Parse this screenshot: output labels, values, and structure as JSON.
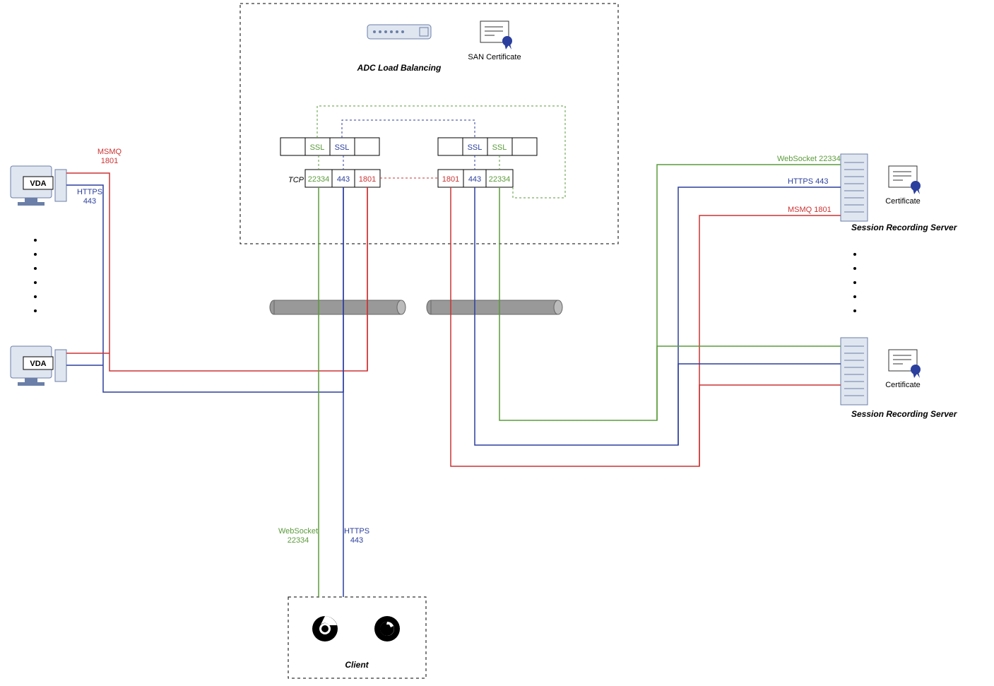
{
  "adc": {
    "title": "ADC Load Balancing",
    "san": "SAN Certificate"
  },
  "ssl": [
    "SSL",
    "SSL",
    "SSL",
    "SSL"
  ],
  "tcpRow": {
    "label": "TCP",
    "p": [
      "22334",
      "443",
      "1801",
      "1801",
      "443",
      "22334"
    ]
  },
  "vda": {
    "label": "VDA",
    "msmq": "MSMQ",
    "p1801": "1801",
    "https": "HTTPS",
    "p443": "443"
  },
  "srs": {
    "label": "Session Recording Server",
    "cert": "Certificate",
    "ws": "WebSocket  22334",
    "https": "HTTPS  443",
    "msmq": "MSMQ  1801"
  },
  "client": {
    "label": "Client",
    "ws": "WebSocket",
    "p22334": "22334",
    "https": "HTTPS",
    "p443": "443"
  },
  "colors": {
    "red": "#cc3333",
    "blue": "#2b3f9e",
    "green": "#5b9b3b"
  }
}
